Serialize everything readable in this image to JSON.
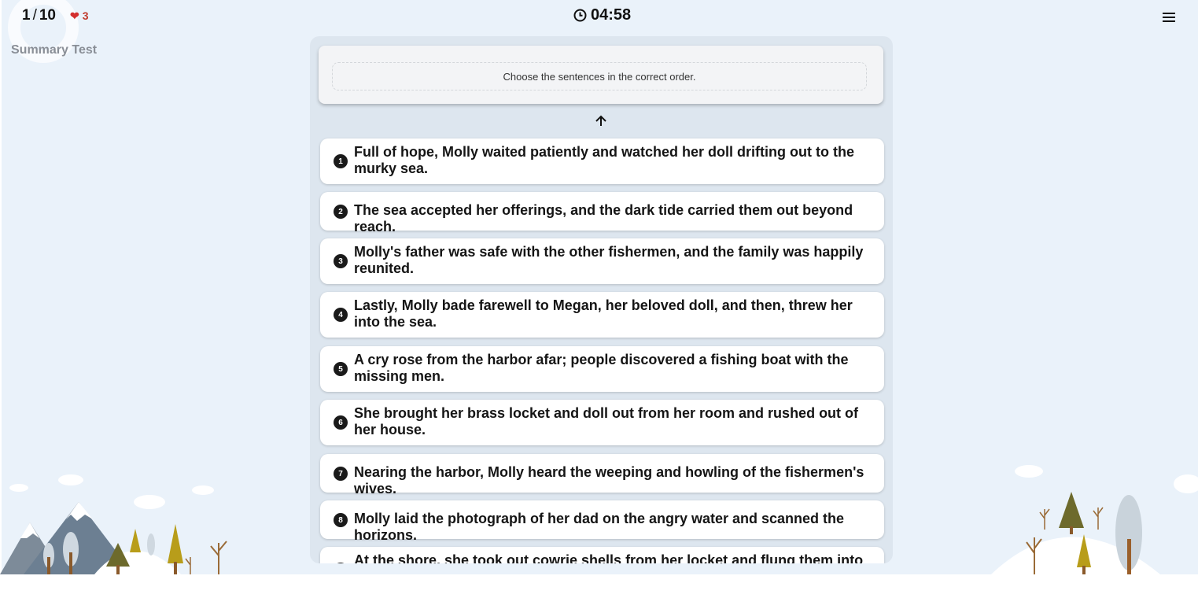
{
  "header": {
    "progress_current": "1",
    "progress_separator": "/",
    "progress_total": "10",
    "lives": "3",
    "test_title": "Summary Test",
    "timer": "04:58"
  },
  "prompt": {
    "instruction": "Choose the sentences in the correct order."
  },
  "sentences": [
    {
      "number": "1",
      "text": "Full of hope, Molly waited patiently and watched her doll drifting out to the murky sea."
    },
    {
      "number": "2",
      "text": "The sea accepted her offerings, and the dark tide carried them out beyond reach."
    },
    {
      "number": "3",
      "text": "Molly's father was safe with the other fishermen, and the family was happily reunited."
    },
    {
      "number": "4",
      "text": "Lastly, Molly bade farewell to Megan, her beloved doll, and then, threw her into the sea."
    },
    {
      "number": "5",
      "text": "A cry rose from the harbor afar; people discovered a fishing boat with the missing men."
    },
    {
      "number": "6",
      "text": "She brought her brass locket and doll out from her room and rushed out of her house."
    },
    {
      "number": "7",
      "text": "Nearing the harbor, Molly heard the weeping and howling of the fishermen's wives."
    },
    {
      "number": "8",
      "text": "Molly laid the photograph of her dad on the angry water and scanned the horizons."
    },
    {
      "number": "9",
      "text": "At the shore, she took out cowrie shells from her locket and flung them into the"
    }
  ],
  "icons": {
    "lives": "heart-icon",
    "timer": "clock-icon",
    "menu": "hamburger-menu-icon",
    "scroll": "arrow-up-icon"
  },
  "colors": {
    "background": "#eaf2fa",
    "panel": "#dde6ef",
    "heart": "#d32f2f",
    "number_badge": "#1a1a1a"
  }
}
